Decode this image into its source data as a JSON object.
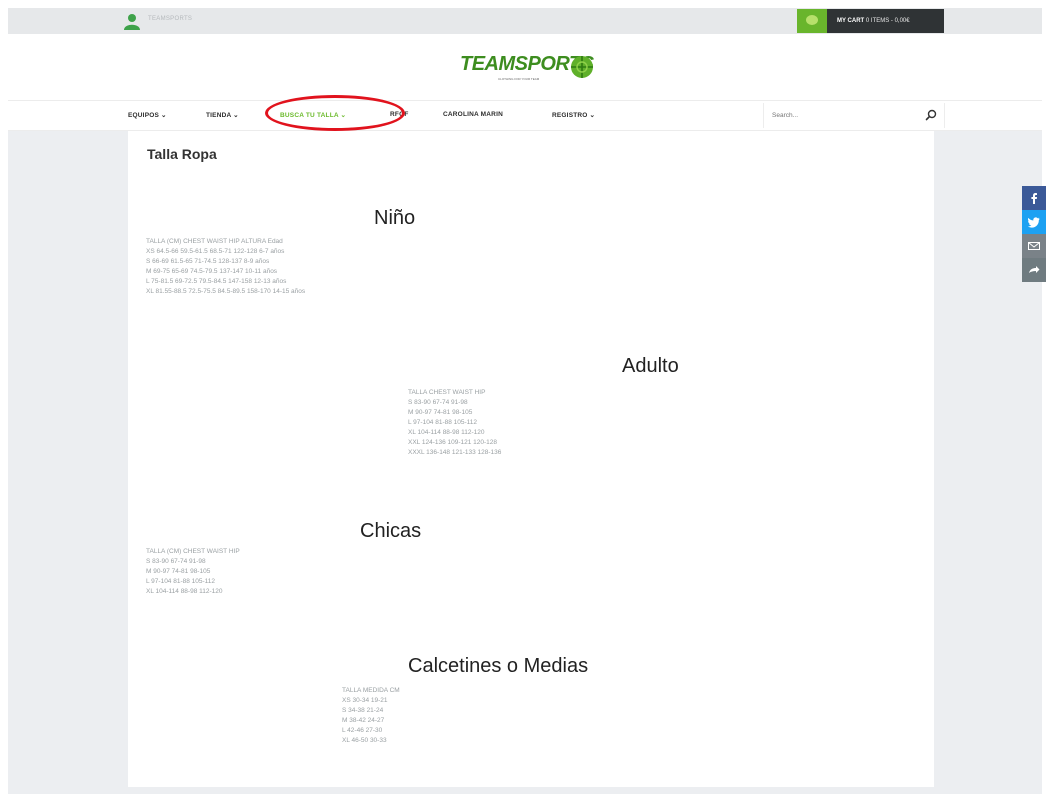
{
  "topbar": {
    "user_label": "TEAMSPORTS",
    "cart_label": "MY CART",
    "cart_summary": "0 ITEMS - 0,00€"
  },
  "logo": {
    "text": "TEAMSPORTS",
    "tagline": "CLOTHING FOR YOUR TEAM"
  },
  "nav": {
    "items": [
      {
        "label": "EQUIPOS ⌄"
      },
      {
        "label": "TIENDA ⌄"
      },
      {
        "label": "BUSCA TU TALLA ⌄"
      },
      {
        "label": "RFGF"
      },
      {
        "label": "CAROLINA MARIN"
      },
      {
        "label": "REGISTRO ⌄"
      }
    ],
    "search_placeholder": "Search..."
  },
  "page": {
    "title": "Talla Ropa"
  },
  "sections": [
    {
      "heading": "Niño",
      "lines": [
        "TALLA (CM) CHEST WAIST HIP ALTURA Edad",
        "XS 64.5-66 59.5-61.5 68.5-71 122-128 6-7 años",
        "S 66-69 61.5-65 71-74.5 128-137 8-9 años",
        "M 69-75 65-69 74.5-79.5 137-147 10-11 años",
        "L 75-81.5 69-72.5 79.5-84.5 147-158 12-13 años",
        "XL 81.55-88.5 72.5-75.5 84.5-89.5 158-170 14-15 años"
      ]
    },
    {
      "heading": "Adulto",
      "lines": [
        "TALLA CHEST WAIST HIP",
        "S 83-90 67-74 91-98",
        "M 90-97 74-81 98-105",
        "L 97-104 81-88 105-112",
        "XL 104-114 88-98 112-120",
        "XXL 124-136 109-121 120-128",
        "XXXL 136-148 121-133 128-136"
      ]
    },
    {
      "heading": "Chicas",
      "lines": [
        "TALLA (CM) CHEST WAIST HIP",
        "S 83-90 67-74 91-98",
        "M 90-97 74-81 98-105",
        "L 97-104 81-88 105-112",
        "XL 104-114 88-98 112-120"
      ]
    },
    {
      "heading": "Calcetines o Medias",
      "lines": [
        "TALLA MEDIDA CM",
        "XS 30-34 19-21",
        "S 34-38 21-24",
        "M 38-42 24-27",
        "L 42-46 27-30",
        "XL 46-50 30-33"
      ]
    }
  ],
  "colors": {
    "accent_green": "#6cba2c",
    "cart_dark": "#2f3335",
    "highlight_red": "#e1131d",
    "facebook": "#3b5998",
    "twitter": "#1da1f2",
    "email": "#7a8288",
    "share": "#6f7b80"
  },
  "share_icons": [
    "facebook-icon",
    "twitter-icon",
    "email-icon",
    "share-icon"
  ]
}
